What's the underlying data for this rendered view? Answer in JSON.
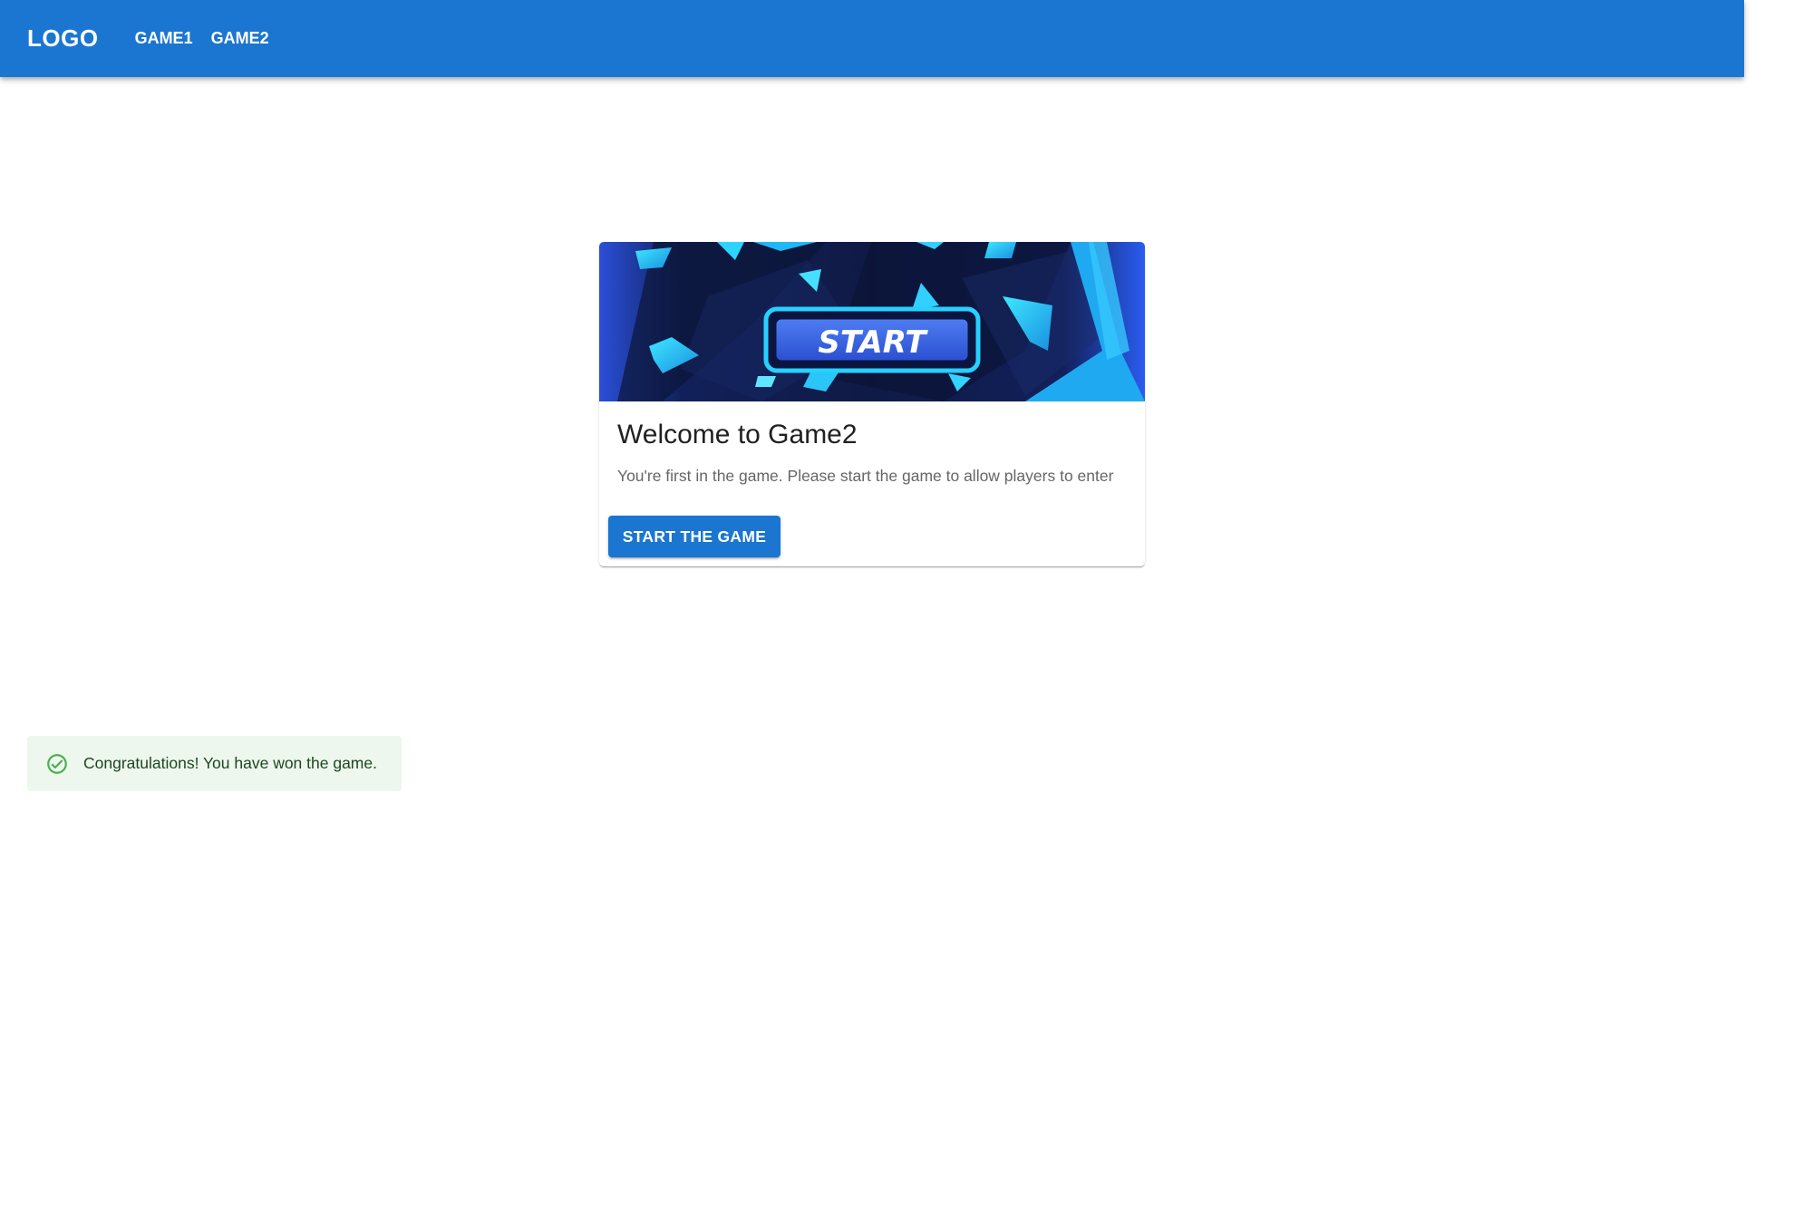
{
  "appbar": {
    "logo": "LOGO",
    "nav": [
      {
        "label": "GAME1"
      },
      {
        "label": "GAME2"
      }
    ]
  },
  "card": {
    "media_text": "START",
    "title": "Welcome to Game2",
    "text": "You're first in the game. Please start the game to allow players to enter",
    "button_label": "START THE GAME"
  },
  "alert": {
    "icon": "check-circle-icon",
    "message": "Congratulations! You have won the game."
  },
  "colors": {
    "primary": "#1b76d2",
    "success_bg": "#edf7ed",
    "success_icon": "#4caf50",
    "success_text": "#1e4620"
  }
}
